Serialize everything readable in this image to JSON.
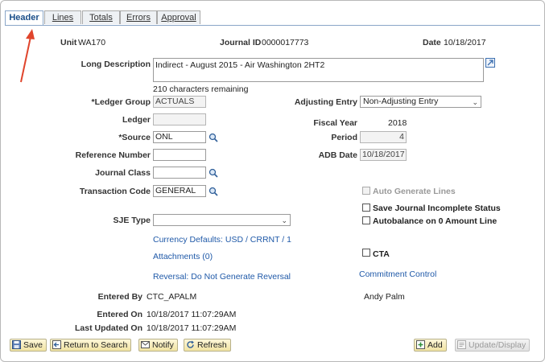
{
  "tabs": [
    {
      "label": "Header"
    },
    {
      "label": "Lines"
    },
    {
      "label": "Totals"
    },
    {
      "label": "Errors"
    },
    {
      "label": "Approval"
    }
  ],
  "header": {
    "unit_label": "Unit",
    "unit_value": "WA170",
    "journal_id_label": "Journal ID",
    "journal_id_value": "0000017773",
    "date_label": "Date",
    "date_value": "10/18/2017"
  },
  "long_description": {
    "label": "Long Description",
    "value": "Indirect - August 2015 - Air Washington 2HT2",
    "remaining": "210 characters remaining"
  },
  "fields": {
    "ledger_group_label": "*Ledger Group",
    "ledger_group_value": "ACTUALS",
    "ledger_label": "Ledger",
    "ledger_value": "",
    "source_label": "*Source",
    "source_value": "ONL",
    "reference_number_label": "Reference Number",
    "reference_number_value": "",
    "journal_class_label": "Journal Class",
    "journal_class_value": "",
    "transaction_code_label": "Transaction Code",
    "transaction_code_value": "GENERAL",
    "sje_type_label": "SJE Type",
    "sje_type_value": "",
    "adjusting_entry_label": "Adjusting Entry",
    "adjusting_entry_value": "Non-Adjusting Entry",
    "fiscal_year_label": "Fiscal Year",
    "fiscal_year_value": "2018",
    "period_label": "Period",
    "period_value": "4",
    "adb_date_label": "ADB Date",
    "adb_date_value": "10/18/2017"
  },
  "checkboxes": {
    "auto_generate": "Auto Generate Lines",
    "save_incomplete": "Save Journal Incomplete Status",
    "autobalance": "Autobalance on 0 Amount Line",
    "cta": "CTA"
  },
  "links": {
    "currency_defaults": "Currency Defaults: USD / CRRNT / 1",
    "attachments": "Attachments (0)",
    "reversal": "Reversal: Do Not Generate Reversal",
    "commitment_control": "Commitment Control"
  },
  "audit": {
    "entered_by_label": "Entered By",
    "entered_by_value": "CTC_APALM",
    "entered_by_name": "Andy Palm",
    "entered_on_label": "Entered On",
    "entered_on_value": "10/18/2017 11:07:29AM",
    "last_updated_label": "Last Updated On",
    "last_updated_value": "10/18/2017 11:07:29AM"
  },
  "buttons": {
    "save": "Save",
    "return": "Return to Search",
    "notify": "Notify",
    "refresh": "Refresh",
    "add": "Add",
    "update": "Update/Display"
  },
  "colors": {
    "link": "#1f59a8",
    "annotation_arrow": "#e0452c",
    "button_bg": "#f1e3a2"
  }
}
